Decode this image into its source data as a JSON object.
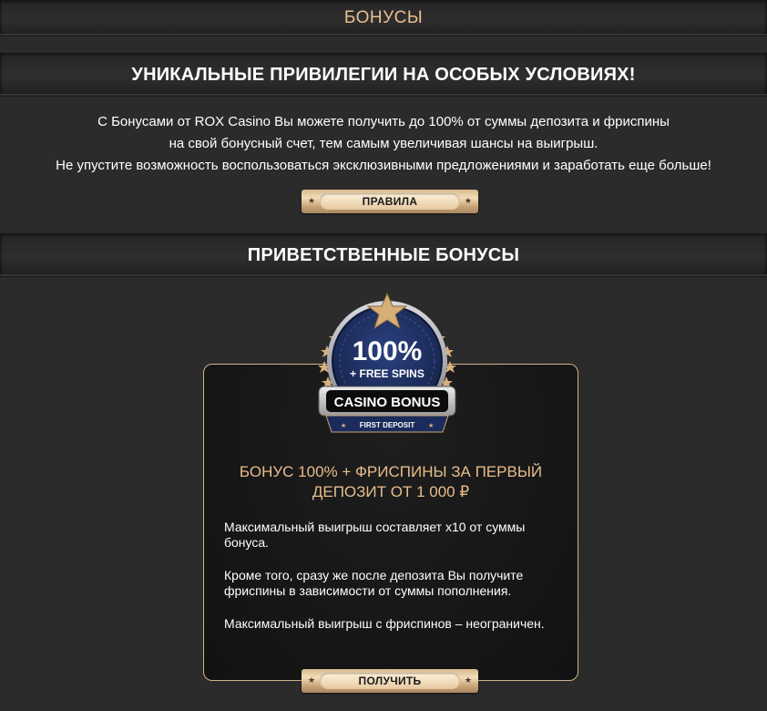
{
  "header": {
    "title": "БОНУСЫ"
  },
  "section_privileges": {
    "heading": "УНИКАЛЬНЫЕ ПРИВИЛЕГИИ НА ОСОБЫХ УСЛОВИЯХ!",
    "lines": [
      "С Бонусами от ROX Casino Вы можете получить до 100% от суммы депозита и фриспины",
      "на свой бонусный счет, тем самым увеличивая шансы на выигрыш.",
      "Не упустите возможность воспользоваться эксклюзивными предложениями и заработать еще больше!"
    ],
    "rules_button": "ПРАВИЛА"
  },
  "section_welcome": {
    "heading": "ПРИВЕТСТВЕННЫЕ БОНУСЫ"
  },
  "bonus_card": {
    "badge": {
      "percent": "100%",
      "free_spins": "+ FREE SPINS",
      "ribbon": "CASINO BONUS",
      "subtitle": "FIRST DEPOSIT"
    },
    "title_line1": "БОНУС 100% + ФРИСПИНЫ ЗА ПЕРВЫЙ",
    "title_line2": "ДЕПОЗИТ ОТ 1 000 ₽",
    "paragraphs": [
      "Максимальный выигрыш составляет х10 от суммы бонуса.",
      "Кроме того, сразу же после депозита Вы получите фриспины в зависимости от суммы пополнения.",
      "Максимальный выигрыш с фриспинов – неограничен."
    ],
    "get_button": "ПОЛУЧИТЬ"
  },
  "colors": {
    "accent_gold": "#e8bd8a",
    "background": "#2b2b2b",
    "card_border": "#d2b489",
    "badge_navy": "#1e2f5e"
  }
}
